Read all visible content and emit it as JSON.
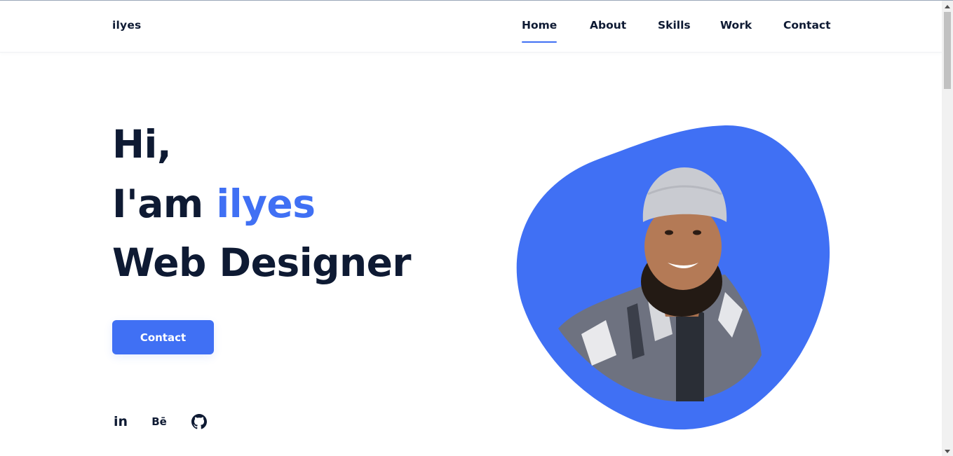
{
  "header": {
    "logo": "ilyes",
    "nav": [
      {
        "label": "Home",
        "active": true
      },
      {
        "label": "About",
        "active": false
      },
      {
        "label": "Skills",
        "active": false
      },
      {
        "label": "Work",
        "active": false
      },
      {
        "label": "Contact",
        "active": false
      }
    ]
  },
  "hero": {
    "line1": "Hi,",
    "line2_prefix": "I'am ",
    "line2_name": "ilyes",
    "line3": "Web Designer",
    "button_label": "Contact"
  },
  "social": [
    {
      "icon": "linkedin-icon",
      "text": "in"
    },
    {
      "icon": "behance-icon",
      "text": "Bē"
    },
    {
      "icon": "github-icon",
      "text": ""
    }
  ],
  "colors": {
    "accent": "#4070f4",
    "text": "#0e1a33",
    "background": "#ffffff"
  }
}
